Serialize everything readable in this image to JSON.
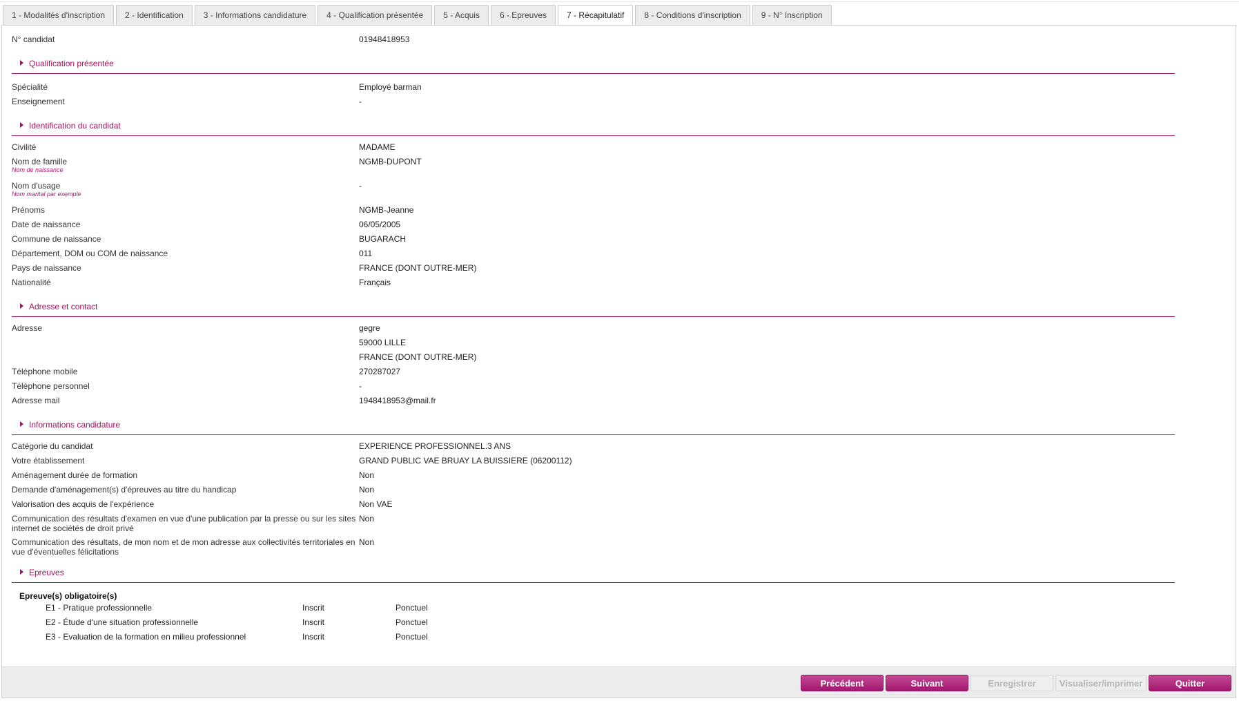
{
  "tabs": [
    {
      "label": "1 - Modalités d'inscription"
    },
    {
      "label": "2 - Identification"
    },
    {
      "label": "3 - Informations candidature"
    },
    {
      "label": "4 - Qualification présentée"
    },
    {
      "label": "5 - Acquis"
    },
    {
      "label": "6 - Epreuves"
    },
    {
      "label": "7 - Récapitulatif"
    },
    {
      "label": "8 - Conditions d'inscription"
    },
    {
      "label": "9 - N° Inscription"
    }
  ],
  "candidate_number": {
    "label": "N° candidat",
    "value": "01948418953"
  },
  "sections": {
    "qualification": {
      "title": "Qualification présentée",
      "specialite": {
        "label": "Spécialité",
        "value": "Employé barman"
      },
      "enseignement": {
        "label": "Enseignement",
        "value": "-"
      }
    },
    "identification": {
      "title": "Identification du candidat",
      "civilite": {
        "label": "Civilité",
        "value": "MADAME"
      },
      "nom_famille": {
        "label": "Nom de famille",
        "hint": "Nom de naissance",
        "value": "NGMB-DUPONT"
      },
      "nom_usage": {
        "label": "Nom d'usage",
        "hint": "Nom marital par exemple",
        "value": "-"
      },
      "prenoms": {
        "label": "Prénoms",
        "value": "NGMB-Jeanne"
      },
      "date_naissance": {
        "label": "Date de naissance",
        "value": "06/05/2005"
      },
      "commune_naissance": {
        "label": "Commune de naissance",
        "value": "BUGARACH"
      },
      "departement": {
        "label": "Département, DOM ou COM de naissance",
        "value": "011"
      },
      "pays_naissance": {
        "label": "Pays de naissance",
        "value": "FRANCE (DONT OUTRE-MER)"
      },
      "nationalite": {
        "label": "Nationalité",
        "value": "Français"
      }
    },
    "adresse": {
      "title": "Adresse et contact",
      "adresse": {
        "label": "Adresse",
        "line1": "gegre",
        "line2": "59000 LILLE",
        "line3": "FRANCE (DONT OUTRE-MER)"
      },
      "tel_mobile": {
        "label": "Téléphone mobile",
        "value": "270287027"
      },
      "tel_perso": {
        "label": "Téléphone personnel",
        "value": "-"
      },
      "mail": {
        "label": "Adresse mail",
        "value": "1948418953@mail.fr"
      }
    },
    "candidature": {
      "title": "Informations candidature",
      "categorie": {
        "label": "Catégorie du candidat",
        "value": "EXPERIENCE PROFESSIONNEL.3 ANS"
      },
      "etablissement": {
        "label": "Votre établissement",
        "value": "GRAND PUBLIC VAE BRUAY LA BUISSIERE (06200112)"
      },
      "amenagement_duree": {
        "label": "Aménagement durée de formation",
        "value": "Non"
      },
      "amenagement_handicap": {
        "label": "Demande d'aménagement(s) d'épreuves au titre du handicap",
        "value": "Non"
      },
      "vae": {
        "label": "Valorisation des acquis de l'expérience",
        "value": "Non VAE"
      },
      "communication_presse": {
        "label": "Communication des résultats d'examen en vue d'une publication par la presse ou sur les sites internet de sociétés de droit privé",
        "value": "Non"
      },
      "communication_collectivites": {
        "label": "Communication des résultats, de mon nom et de mon adresse aux collectivités territoriales en vue d'éventuelles félicitations",
        "value": "Non"
      }
    },
    "epreuves": {
      "title": "Epreuves",
      "group_title": "Epreuve(s) obligatoire(s)",
      "items": [
        {
          "name": "E1 - Pratique professionnelle",
          "status": "Inscrit",
          "mode": "Ponctuel"
        },
        {
          "name": "E2 - Étude d'une situation professionnelle",
          "status": "Inscrit",
          "mode": "Ponctuel"
        },
        {
          "name": "E3 - Evaluation de la formation en milieu professionnel",
          "status": "Inscrit",
          "mode": "Ponctuel"
        }
      ]
    }
  },
  "footer": {
    "precedent": "Précédent",
    "suivant": "Suivant",
    "enregistrer": "Enregistrer",
    "visualiser": "Visualiser/imprimer",
    "quitter": "Quitter"
  },
  "colors": {
    "accent": "#a3135f",
    "button": "#b02e82"
  }
}
